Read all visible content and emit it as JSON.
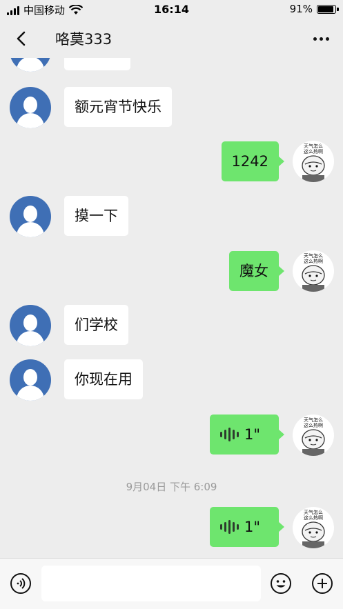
{
  "status_bar": {
    "carrier": "中国移动",
    "time": "16:14",
    "battery_percent": "91%",
    "battery_level": 0.91
  },
  "nav": {
    "title": "咯莫333"
  },
  "messages": [
    {
      "side": "in",
      "text": "额元宵节快乐"
    },
    {
      "side": "out",
      "text": "1242"
    },
    {
      "side": "in",
      "text": "摸一下"
    },
    {
      "side": "out",
      "text": "魔女"
    },
    {
      "side": "in",
      "text": "们学校"
    },
    {
      "side": "in",
      "text": "你现在用"
    },
    {
      "side": "out",
      "type": "voice",
      "duration": "1\""
    },
    {
      "type": "timestamp",
      "text": "9月04日 下午 6:09"
    },
    {
      "side": "out",
      "type": "voice",
      "duration": "1\""
    }
  ],
  "meme_sticker": {
    "line1": "天气怎么",
    "line2": "这么热啊"
  },
  "input_bar": {
    "placeholder": ""
  },
  "colors": {
    "accent": "#6ee56e",
    "avatar": "#3f6fb5",
    "background": "#ededed"
  }
}
